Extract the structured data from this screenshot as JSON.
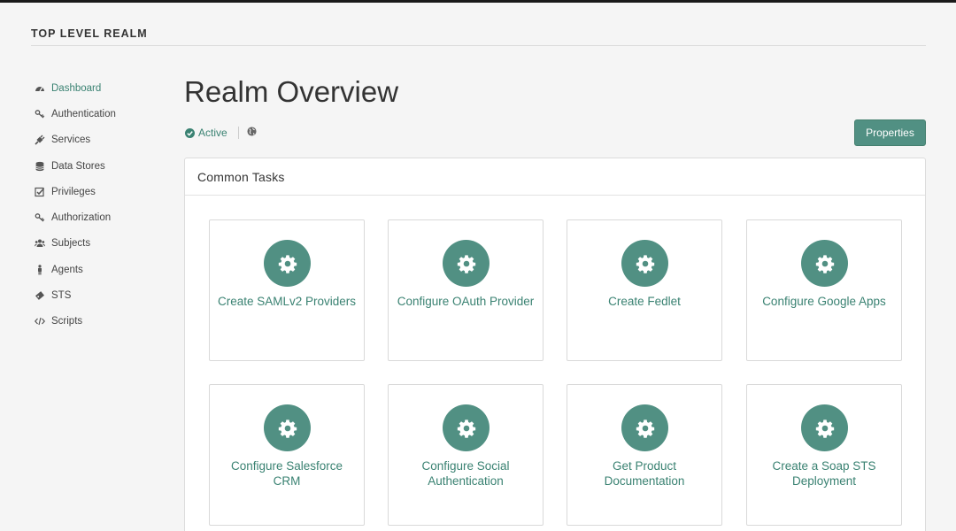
{
  "realm": {
    "title": "TOP LEVEL REALM"
  },
  "sidebar": {
    "items": [
      {
        "label": "Dashboard",
        "icon": "dashboard-icon",
        "active": true
      },
      {
        "label": "Authentication",
        "icon": "key-icon"
      },
      {
        "label": "Services",
        "icon": "plug-icon"
      },
      {
        "label": "Data Stores",
        "icon": "database-icon"
      },
      {
        "label": "Privileges",
        "icon": "checkbox-icon"
      },
      {
        "label": "Authorization",
        "icon": "key-icon"
      },
      {
        "label": "Subjects",
        "icon": "users-icon"
      },
      {
        "label": "Agents",
        "icon": "person-icon"
      },
      {
        "label": "STS",
        "icon": "ticket-icon"
      },
      {
        "label": "Scripts",
        "icon": "code-icon"
      }
    ]
  },
  "page": {
    "title": "Realm Overview",
    "status": "Active",
    "properties_label": "Properties"
  },
  "common_tasks": {
    "title": "Common Tasks",
    "tasks": [
      {
        "label": "Create SAMLv2 Providers",
        "icon": "gear-icon"
      },
      {
        "label": "Configure OAuth Provider",
        "icon": "gear-icon"
      },
      {
        "label": "Create Fedlet",
        "icon": "gear-icon"
      },
      {
        "label": "Configure Google Apps",
        "icon": "gear-icon"
      },
      {
        "label": "Configure Salesforce CRM",
        "icon": "gear-icon"
      },
      {
        "label": "Configure Social Authentication",
        "icon": "gear-icon"
      },
      {
        "label": "Get Product Documentation",
        "icon": "gear-icon"
      },
      {
        "label": "Create a Soap STS Deployment",
        "icon": "gear-icon"
      }
    ]
  },
  "colors": {
    "accent": "#519083",
    "accent_text": "#3a8272",
    "background": "#f5f5f5"
  }
}
